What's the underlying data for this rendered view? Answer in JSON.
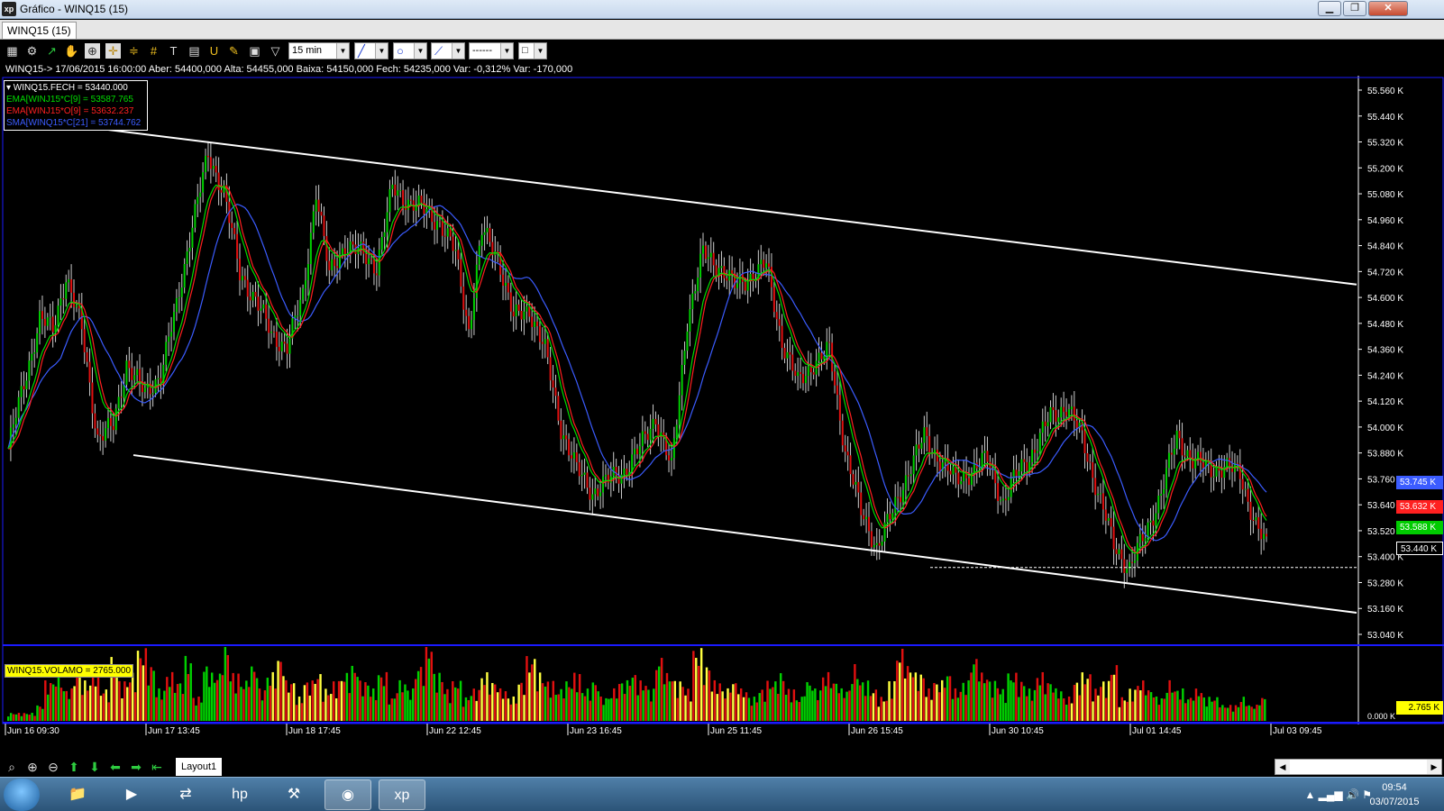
{
  "window": {
    "title": "Gráfico - WINQ15 (15)",
    "app_icon_text": "xp",
    "minimize_glyph": "▁",
    "maximize_glyph": "❐",
    "close_glyph": "✕"
  },
  "tabs": [
    {
      "label": "WINQ15 (15)",
      "active": true
    }
  ],
  "toolbar": {
    "interval": "15 min",
    "line_style": "------",
    "icons": [
      "chart-type-icon",
      "settings-icon",
      "indicator-icon",
      "hand-icon",
      "zoom-area-icon",
      "crosshair-icon",
      "parallel-lines-icon",
      "grid-lines-icon",
      "text-icon",
      "fibonacci-icon",
      "pencil-icon",
      "clipboard-icon",
      "filter-icon"
    ]
  },
  "info_line": "WINQ15-> 17/06/2015 16:00:00 Aber: 54400,000 Alta: 54455,000 Baixa: 54150,000 Fech: 54235,000 Var: -0,312% Var: -170,000",
  "legend": [
    {
      "text": "▾ WINQ15.FECH = 53440.000",
      "color": "#ffffff"
    },
    {
      "text": "EMA[WINJ15*C[9] = 53587.765",
      "color": "#00dd00"
    },
    {
      "text": "EMA[WINJ15*O[9] = 53632.237",
      "color": "#ff2020"
    },
    {
      "text": "SMA[WINQ15*C[21] = 53744.762",
      "color": "#3b5cff"
    }
  ],
  "volume_label": "WINQ15.VOLAMO = 2765.000",
  "chart_data": {
    "type": "candlestick-line",
    "series": [
      {
        "name": "WINQ15.FECH",
        "color": "#ffffff"
      },
      {
        "name": "EMA[WINJ15*C[9]",
        "color": "#00dd00"
      },
      {
        "name": "EMA[WINJ15*O[9]",
        "color": "#ff2020"
      },
      {
        "name": "SMA[WINQ15*C[21]",
        "color": "#3b5cff"
      }
    ],
    "price_axis_labels": [
      "55.560 K",
      "55.440 K",
      "55.320 K",
      "55.200 K",
      "55.080 K",
      "54.960 K",
      "54.840 K",
      "54.720 K",
      "54.600 K",
      "54.480 K",
      "54.360 K",
      "54.240 K",
      "54.120 K",
      "54.000 K",
      "53.880 K",
      "53.760 K",
      "53.640 K",
      "53.520 K",
      "53.400 K",
      "53.280 K",
      "53.160 K",
      "53.040 K"
    ],
    "price_ylim": [
      53040,
      55560
    ],
    "time_axis_labels": [
      "Jun 16 09:30",
      "Jun 17 13:45",
      "Jun 18 17:45",
      "Jun 22 12:45",
      "Jun 23 16:45",
      "Jun 25 11:45",
      "Jun 26 15:45",
      "Jun 30 10:45",
      "Jul 01 14:45",
      "Jul 03 09:45"
    ],
    "close_path": [
      [
        0,
        53900
      ],
      [
        6,
        54200
      ],
      [
        12,
        54500
      ],
      [
        17,
        54450
      ],
      [
        22,
        54700
      ],
      [
        28,
        54450
      ],
      [
        34,
        53950
      ],
      [
        40,
        54000
      ],
      [
        45,
        54300
      ],
      [
        52,
        54150
      ],
      [
        58,
        54250
      ],
      [
        64,
        54550
      ],
      [
        70,
        54950
      ],
      [
        76,
        55250
      ],
      [
        82,
        55100
      ],
      [
        88,
        54700
      ],
      [
        94,
        54600
      ],
      [
        100,
        54420
      ],
      [
        106,
        54380
      ],
      [
        112,
        54600
      ],
      [
        117,
        55100
      ],
      [
        122,
        54700
      ],
      [
        128,
        54850
      ],
      [
        134,
        54800
      ],
      [
        140,
        54750
      ],
      [
        146,
        55100
      ],
      [
        152,
        55050
      ],
      [
        158,
        55000
      ],
      [
        164,
        54950
      ],
      [
        170,
        54800
      ],
      [
        175,
        54450
      ],
      [
        180,
        54900
      ],
      [
        186,
        54800
      ],
      [
        192,
        54500
      ],
      [
        198,
        54550
      ],
      [
        204,
        54350
      ],
      [
        210,
        54000
      ],
      [
        216,
        53800
      ],
      [
        222,
        53700
      ],
      [
        228,
        53750
      ],
      [
        234,
        53800
      ],
      [
        240,
        53900
      ],
      [
        246,
        54050
      ],
      [
        252,
        53800
      ],
      [
        258,
        54500
      ],
      [
        264,
        54800
      ],
      [
        270,
        54750
      ],
      [
        276,
        54650
      ],
      [
        282,
        54700
      ],
      [
        288,
        54750
      ],
      [
        294,
        54400
      ],
      [
        300,
        54200
      ],
      [
        306,
        54300
      ],
      [
        312,
        54350
      ],
      [
        318,
        53900
      ],
      [
        324,
        53600
      ],
      [
        330,
        53450
      ],
      [
        336,
        53600
      ],
      [
        342,
        53800
      ],
      [
        348,
        53950
      ],
      [
        354,
        53850
      ],
      [
        360,
        53750
      ],
      [
        366,
        53800
      ],
      [
        372,
        53850
      ],
      [
        378,
        53650
      ],
      [
        384,
        53800
      ],
      [
        390,
        53900
      ],
      [
        396,
        54050
      ],
      [
        402,
        54100
      ],
      [
        408,
        53950
      ],
      [
        414,
        53700
      ],
      [
        420,
        53450
      ],
      [
        426,
        53350
      ],
      [
        432,
        53500
      ],
      [
        438,
        53700
      ],
      [
        444,
        53950
      ],
      [
        450,
        53850
      ],
      [
        456,
        53800
      ],
      [
        462,
        53820
      ],
      [
        468,
        53780
      ],
      [
        474,
        53550
      ],
      [
        478,
        53440
      ]
    ],
    "volume": [
      0.1,
      0.1,
      0.1,
      0.2,
      0.5,
      0.6,
      0.4,
      0.6,
      0.5,
      0.7,
      0.4,
      0.8,
      0.5,
      0.6,
      0.9,
      0.7,
      0.4,
      0.6,
      0.5,
      0.8,
      0.3,
      0.7,
      0.6,
      1.0,
      0.6,
      0.5,
      0.7,
      0.4,
      0.6,
      0.8,
      0.5,
      0.3,
      0.5,
      0.6,
      0.4,
      0.5,
      0.6,
      0.7,
      0.5,
      0.4,
      0.6,
      0.3,
      0.5,
      0.4,
      0.7,
      1.0,
      0.6,
      0.4,
      0.5,
      0.3,
      0.4,
      0.6,
      0.5,
      0.4,
      0.3,
      0.5,
      0.8,
      0.6,
      0.5,
      0.4,
      0.5,
      0.6,
      0.4,
      0.5,
      0.3,
      0.4,
      0.5,
      0.6,
      0.5,
      0.4,
      0.8,
      0.6,
      0.5,
      0.4,
      0.9,
      0.7,
      0.5,
      0.4,
      0.5,
      0.4,
      0.3,
      0.4,
      0.5,
      0.6,
      0.4,
      0.3,
      0.5,
      0.4,
      0.6,
      0.5,
      0.4,
      0.7,
      0.5,
      0.4,
      0.3,
      0.5,
      0.9,
      0.7,
      0.6,
      0.4,
      0.5,
      0.6,
      0.4,
      0.5,
      0.8,
      0.6,
      0.5,
      0.4,
      0.6,
      0.5,
      0.4,
      0.6,
      0.5,
      0.4,
      0.3,
      0.5,
      0.6,
      0.4,
      0.5,
      0.7,
      0.3,
      0.4,
      0.5,
      0.4,
      0.3,
      0.5,
      0.4,
      0.3,
      0.4,
      0.3,
      0.3,
      0.2,
      0.2,
      0.3,
      0.2,
      0.3
    ],
    "channel_upper": [
      [
        16,
        55430
      ],
      [
        1505,
        54660
      ]
    ],
    "channel_lower": [
      [
        148,
        53870
      ],
      [
        1505,
        53140
      ]
    ],
    "support_line": 53350,
    "price_tags": [
      {
        "text": "53.745 K",
        "color": "#3b5cff",
        "value": 53745
      },
      {
        "text": "53.632 K",
        "color": "#ff2020",
        "value": 53632
      },
      {
        "text": "53.588 K",
        "color": "#00cc00",
        "value": 53588
      },
      {
        "text": "53.440 K",
        "color": "#000000",
        "value": 53440
      }
    ],
    "volume_tag": "2.765 K",
    "volume_axis_label": "0.000 K"
  },
  "bottombar": {
    "layout_tab": "Layout1",
    "icons": [
      "zoom-icon",
      "zoom-in-icon",
      "zoom-out-icon",
      "arrow-up-icon",
      "arrow-down-icon",
      "arrow-left-icon",
      "arrow-right-icon",
      "arrow-end-icon"
    ]
  },
  "taskbar": {
    "apps": [
      "explorer-icon",
      "media-player-icon",
      "network-icon",
      "hp-icon",
      "tools-icon",
      "chrome-icon",
      "xp-app-icon"
    ],
    "clock_time": "09:54",
    "clock_date": "03/07/2015"
  }
}
